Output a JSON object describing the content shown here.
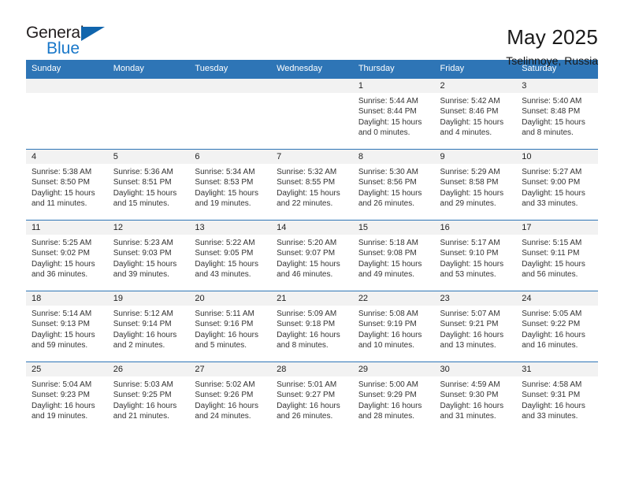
{
  "logo": {
    "word_one": "General",
    "word_two": "Blue",
    "triangle_color": "#1065ad",
    "blue_color": "#1877c9"
  },
  "header": {
    "title": "May 2025",
    "subtitle": "Tselinnoye, Russia",
    "header_bg": "#2e75b6"
  },
  "weekdays": [
    "Sunday",
    "Monday",
    "Tuesday",
    "Wednesday",
    "Thursday",
    "Friday",
    "Saturday"
  ],
  "labels": {
    "sunrise": "Sunrise:",
    "sunset": "Sunset:",
    "daylight": "Daylight:"
  },
  "weeks": [
    [
      {
        "day": ""
      },
      {
        "day": ""
      },
      {
        "day": ""
      },
      {
        "day": ""
      },
      {
        "day": "1",
        "sunrise": "Sunrise: 5:44 AM",
        "sunset": "Sunset: 8:44 PM",
        "daylight_1": "Daylight: 15 hours",
        "daylight_2": "and 0 minutes."
      },
      {
        "day": "2",
        "sunrise": "Sunrise: 5:42 AM",
        "sunset": "Sunset: 8:46 PM",
        "daylight_1": "Daylight: 15 hours",
        "daylight_2": "and 4 minutes."
      },
      {
        "day": "3",
        "sunrise": "Sunrise: 5:40 AM",
        "sunset": "Sunset: 8:48 PM",
        "daylight_1": "Daylight: 15 hours",
        "daylight_2": "and 8 minutes."
      }
    ],
    [
      {
        "day": "4",
        "sunrise": "Sunrise: 5:38 AM",
        "sunset": "Sunset: 8:50 PM",
        "daylight_1": "Daylight: 15 hours",
        "daylight_2": "and 11 minutes."
      },
      {
        "day": "5",
        "sunrise": "Sunrise: 5:36 AM",
        "sunset": "Sunset: 8:51 PM",
        "daylight_1": "Daylight: 15 hours",
        "daylight_2": "and 15 minutes."
      },
      {
        "day": "6",
        "sunrise": "Sunrise: 5:34 AM",
        "sunset": "Sunset: 8:53 PM",
        "daylight_1": "Daylight: 15 hours",
        "daylight_2": "and 19 minutes."
      },
      {
        "day": "7",
        "sunrise": "Sunrise: 5:32 AM",
        "sunset": "Sunset: 8:55 PM",
        "daylight_1": "Daylight: 15 hours",
        "daylight_2": "and 22 minutes."
      },
      {
        "day": "8",
        "sunrise": "Sunrise: 5:30 AM",
        "sunset": "Sunset: 8:56 PM",
        "daylight_1": "Daylight: 15 hours",
        "daylight_2": "and 26 minutes."
      },
      {
        "day": "9",
        "sunrise": "Sunrise: 5:29 AM",
        "sunset": "Sunset: 8:58 PM",
        "daylight_1": "Daylight: 15 hours",
        "daylight_2": "and 29 minutes."
      },
      {
        "day": "10",
        "sunrise": "Sunrise: 5:27 AM",
        "sunset": "Sunset: 9:00 PM",
        "daylight_1": "Daylight: 15 hours",
        "daylight_2": "and 33 minutes."
      }
    ],
    [
      {
        "day": "11",
        "sunrise": "Sunrise: 5:25 AM",
        "sunset": "Sunset: 9:02 PM",
        "daylight_1": "Daylight: 15 hours",
        "daylight_2": "and 36 minutes."
      },
      {
        "day": "12",
        "sunrise": "Sunrise: 5:23 AM",
        "sunset": "Sunset: 9:03 PM",
        "daylight_1": "Daylight: 15 hours",
        "daylight_2": "and 39 minutes."
      },
      {
        "day": "13",
        "sunrise": "Sunrise: 5:22 AM",
        "sunset": "Sunset: 9:05 PM",
        "daylight_1": "Daylight: 15 hours",
        "daylight_2": "and 43 minutes."
      },
      {
        "day": "14",
        "sunrise": "Sunrise: 5:20 AM",
        "sunset": "Sunset: 9:07 PM",
        "daylight_1": "Daylight: 15 hours",
        "daylight_2": "and 46 minutes."
      },
      {
        "day": "15",
        "sunrise": "Sunrise: 5:18 AM",
        "sunset": "Sunset: 9:08 PM",
        "daylight_1": "Daylight: 15 hours",
        "daylight_2": "and 49 minutes."
      },
      {
        "day": "16",
        "sunrise": "Sunrise: 5:17 AM",
        "sunset": "Sunset: 9:10 PM",
        "daylight_1": "Daylight: 15 hours",
        "daylight_2": "and 53 minutes."
      },
      {
        "day": "17",
        "sunrise": "Sunrise: 5:15 AM",
        "sunset": "Sunset: 9:11 PM",
        "daylight_1": "Daylight: 15 hours",
        "daylight_2": "and 56 minutes."
      }
    ],
    [
      {
        "day": "18",
        "sunrise": "Sunrise: 5:14 AM",
        "sunset": "Sunset: 9:13 PM",
        "daylight_1": "Daylight: 15 hours",
        "daylight_2": "and 59 minutes."
      },
      {
        "day": "19",
        "sunrise": "Sunrise: 5:12 AM",
        "sunset": "Sunset: 9:14 PM",
        "daylight_1": "Daylight: 16 hours",
        "daylight_2": "and 2 minutes."
      },
      {
        "day": "20",
        "sunrise": "Sunrise: 5:11 AM",
        "sunset": "Sunset: 9:16 PM",
        "daylight_1": "Daylight: 16 hours",
        "daylight_2": "and 5 minutes."
      },
      {
        "day": "21",
        "sunrise": "Sunrise: 5:09 AM",
        "sunset": "Sunset: 9:18 PM",
        "daylight_1": "Daylight: 16 hours",
        "daylight_2": "and 8 minutes."
      },
      {
        "day": "22",
        "sunrise": "Sunrise: 5:08 AM",
        "sunset": "Sunset: 9:19 PM",
        "daylight_1": "Daylight: 16 hours",
        "daylight_2": "and 10 minutes."
      },
      {
        "day": "23",
        "sunrise": "Sunrise: 5:07 AM",
        "sunset": "Sunset: 9:21 PM",
        "daylight_1": "Daylight: 16 hours",
        "daylight_2": "and 13 minutes."
      },
      {
        "day": "24",
        "sunrise": "Sunrise: 5:05 AM",
        "sunset": "Sunset: 9:22 PM",
        "daylight_1": "Daylight: 16 hours",
        "daylight_2": "and 16 minutes."
      }
    ],
    [
      {
        "day": "25",
        "sunrise": "Sunrise: 5:04 AM",
        "sunset": "Sunset: 9:23 PM",
        "daylight_1": "Daylight: 16 hours",
        "daylight_2": "and 19 minutes."
      },
      {
        "day": "26",
        "sunrise": "Sunrise: 5:03 AM",
        "sunset": "Sunset: 9:25 PM",
        "daylight_1": "Daylight: 16 hours",
        "daylight_2": "and 21 minutes."
      },
      {
        "day": "27",
        "sunrise": "Sunrise: 5:02 AM",
        "sunset": "Sunset: 9:26 PM",
        "daylight_1": "Daylight: 16 hours",
        "daylight_2": "and 24 minutes."
      },
      {
        "day": "28",
        "sunrise": "Sunrise: 5:01 AM",
        "sunset": "Sunset: 9:27 PM",
        "daylight_1": "Daylight: 16 hours",
        "daylight_2": "and 26 minutes."
      },
      {
        "day": "29",
        "sunrise": "Sunrise: 5:00 AM",
        "sunset": "Sunset: 9:29 PM",
        "daylight_1": "Daylight: 16 hours",
        "daylight_2": "and 28 minutes."
      },
      {
        "day": "30",
        "sunrise": "Sunrise: 4:59 AM",
        "sunset": "Sunset: 9:30 PM",
        "daylight_1": "Daylight: 16 hours",
        "daylight_2": "and 31 minutes."
      },
      {
        "day": "31",
        "sunrise": "Sunrise: 4:58 AM",
        "sunset": "Sunset: 9:31 PM",
        "daylight_1": "Daylight: 16 hours",
        "daylight_2": "and 33 minutes."
      }
    ]
  ]
}
